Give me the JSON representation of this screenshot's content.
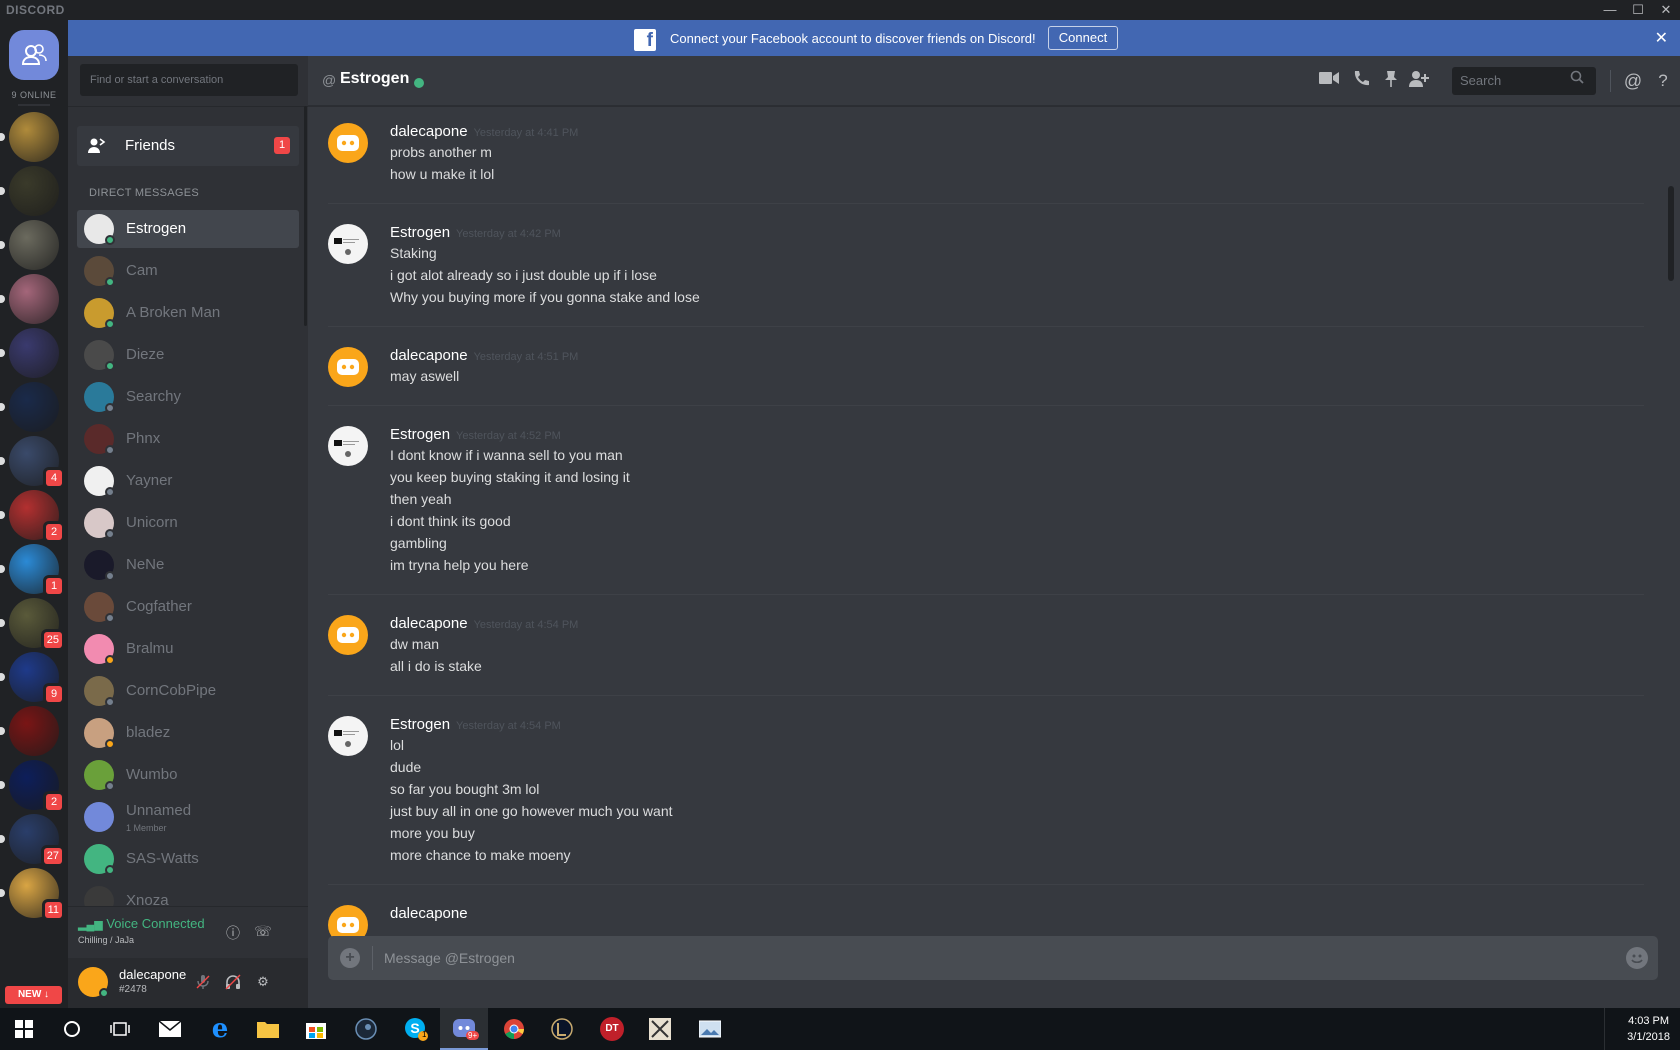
{
  "app": {
    "logo": "DISCORD"
  },
  "window_controls": {
    "minimize": "—",
    "maximize": "☐",
    "close": "✕"
  },
  "guilds": {
    "online_label": "9 ONLINE",
    "new_label": "NEW ↓",
    "items": [
      {
        "color": "#b08b3b",
        "badge": ""
      },
      {
        "color": "#3a3a2a",
        "badge": ""
      },
      {
        "color": "#6b6a5e",
        "badge": ""
      },
      {
        "color": "#a4667a",
        "badge": ""
      },
      {
        "color": "#3a3a6e",
        "badge": ""
      },
      {
        "color": "#1a2a4a",
        "badge": ""
      },
      {
        "color": "#3a4a6a",
        "badge": "4"
      },
      {
        "color": "#b33030",
        "badge": "2"
      },
      {
        "color": "#2b8ad6",
        "badge": "1"
      },
      {
        "color": "#5a5a3a",
        "badge": "25"
      },
      {
        "color": "#1e3a8a",
        "badge": "9"
      },
      {
        "color": "#7a1515",
        "badge": ""
      },
      {
        "color": "#0d1e5a",
        "badge": "2"
      },
      {
        "color": "#2a3e6a",
        "badge": "27"
      },
      {
        "color": "#d9a544",
        "badge": "11"
      }
    ]
  },
  "sidebar": {
    "search_placeholder": "Find or start a conversation",
    "friends_label": "Friends",
    "friends_badge": "1",
    "dm_header": "DIRECT MESSAGES",
    "dms": [
      {
        "name": "Estrogen",
        "status": "#43b581",
        "avatar": "#e8e8e8",
        "active": true
      },
      {
        "name": "Cam",
        "status": "#43b581",
        "avatar": "#5b4a3a"
      },
      {
        "name": "A Broken Man",
        "status": "#43b581",
        "avatar": "#c99b2e"
      },
      {
        "name": "Dieze",
        "status": "#43b581",
        "avatar": "#4a4a4a"
      },
      {
        "name": "Searchy",
        "status": "#747f8d",
        "avatar": "#2a7a9a"
      },
      {
        "name": "Phnx",
        "status": "#747f8d",
        "avatar": "#5a2a2a"
      },
      {
        "name": "Yayner",
        "status": "#747f8d",
        "avatar": "#f0f0f0"
      },
      {
        "name": "Unicorn",
        "status": "#747f8d",
        "avatar": "#d8c8c8"
      },
      {
        "name": "NeNe",
        "status": "#747f8d",
        "avatar": "#1a1a2a"
      },
      {
        "name": "Cogfather",
        "status": "#747f8d",
        "avatar": "#6a4a3a"
      },
      {
        "name": "Bralmu",
        "status": "#faa61a",
        "avatar": "#f28bb0"
      },
      {
        "name": "CornCobPipe",
        "status": "#747f8d",
        "avatar": "#7a6a4a"
      },
      {
        "name": "bladez",
        "status": "#faa61a",
        "avatar": "#c8a080"
      },
      {
        "name": "Wumbo",
        "status": "#747f8d",
        "avatar": "#6aa03a"
      },
      {
        "name": "Unnamed",
        "sub": "1 Member",
        "status": "",
        "avatar": "#7289da",
        "group": true
      },
      {
        "name": "SAS-Watts",
        "status": "#43b581",
        "avatar": "#43b581"
      },
      {
        "name": "Xnoza",
        "status": "#747f8d",
        "avatar": "#3a3a3a"
      }
    ],
    "voice": {
      "status": "Voice Connected",
      "channel": "Chilling / JaJa"
    },
    "user": {
      "name": "dalecapone",
      "tag": "#2478"
    }
  },
  "banner": {
    "text": "Connect your Facebook account to discover friends on Discord!",
    "button": "Connect",
    "fb_icon": "f",
    "close_icon": "✕"
  },
  "header": {
    "channel_name": "Estrogen",
    "search_placeholder": "Search"
  },
  "messages": [
    {
      "author": "dalecapone",
      "time": "Yesterday at 4:41 PM",
      "avatar": "discord",
      "lines": [
        "probs another m",
        "how u make it lol"
      ]
    },
    {
      "author": "Estrogen",
      "time": "Yesterday at 4:42 PM",
      "avatar": "estrogen",
      "lines": [
        "Staking",
        "i got alot already so i just double up if i lose",
        "Why you buying more if you gonna stake and lose"
      ]
    },
    {
      "author": "dalecapone",
      "time": "Yesterday at 4:51 PM",
      "avatar": "discord",
      "lines": [
        "may aswell"
      ]
    },
    {
      "author": "Estrogen",
      "time": "Yesterday at 4:52 PM",
      "avatar": "estrogen",
      "lines": [
        "I dont know if i wanna sell to you man",
        "you keep buying staking it and losing it",
        "then yeah",
        "i dont think its good",
        "gambling",
        "im tryna help you here"
      ]
    },
    {
      "author": "dalecapone",
      "time": "Yesterday at 4:54 PM",
      "avatar": "discord",
      "lines": [
        "dw man",
        "all i do is stake"
      ]
    },
    {
      "author": "Estrogen",
      "time": "Yesterday at 4:54 PM",
      "avatar": "estrogen",
      "lines": [
        "lol",
        "dude",
        "so far you bought 3m lol",
        "just buy all in one go however much you want",
        "more you buy",
        "more chance to make moeny"
      ]
    },
    {
      "author": "dalecapone",
      "time": "",
      "avatar": "discord",
      "lines": []
    }
  ],
  "composer": {
    "placeholder": "Message @Estrogen"
  },
  "taskbar": {
    "time": "4:03 PM",
    "date": "3/1/2018",
    "skype_badge": "1",
    "discord_badge": "9+",
    "dt_label": "DT"
  }
}
